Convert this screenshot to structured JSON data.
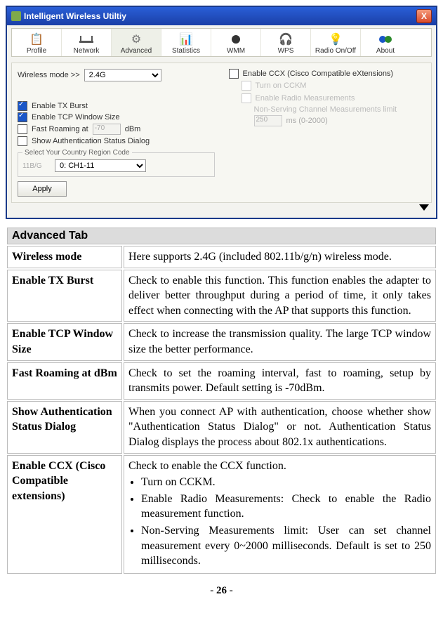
{
  "window": {
    "title": "Intelligent Wireless Utiltiy",
    "close": "X"
  },
  "toolbar": {
    "items": [
      {
        "label": "Profile",
        "icon": "📋"
      },
      {
        "label": "Network",
        "icon": "📶"
      },
      {
        "label": "Advanced",
        "icon": "⚙",
        "active": true
      },
      {
        "label": "Statistics",
        "icon": "📊"
      },
      {
        "label": "WMM",
        "icon": "🎚"
      },
      {
        "label": "WPS",
        "icon": "🔒"
      },
      {
        "label": "Radio On/Off",
        "icon": "💡"
      },
      {
        "label": "About",
        "icon": "ℹ"
      }
    ]
  },
  "wireless_mode": {
    "label": "Wireless mode >>",
    "value": "2.4G"
  },
  "left": {
    "enable_tx_burst": {
      "label": "Enable TX Burst",
      "checked": true
    },
    "enable_tcp_window": {
      "label": "Enable TCP Window Size",
      "checked": true
    },
    "fast_roaming": {
      "label": "Fast Roaming at",
      "checked": false,
      "value": "-70",
      "unit": "dBm"
    },
    "show_auth": {
      "label": "Show Authentication Status Dialog",
      "checked": false
    },
    "region_legend": "Select Your Country Region Code",
    "region_prefix": "11B/G",
    "region_value": "0: CH1-11"
  },
  "right": {
    "enable_ccx": {
      "label": "Enable CCX (Cisco Compatible eXtensions)",
      "checked": false
    },
    "turn_on_cckm": "Turn on CCKM",
    "enable_radio": "Enable Radio Measurements",
    "non_serving": "Non-Serving Channel Measurements limit",
    "ms_value": "250",
    "ms_range": "ms (0-2000)"
  },
  "apply": "Apply",
  "doc": {
    "header": "Advanced Tab",
    "rows": [
      {
        "key": "Wireless mode",
        "desc": "Here supports 2.4G (included 802.11b/g/n) wireless mode."
      },
      {
        "key": "Enable TX Burst",
        "desc": "Check to enable this function. This function enables the adapter to deliver better throughput during a period of time, it only takes effect when connecting with the AP that supports this function."
      },
      {
        "key": "Enable TCP Window Size",
        "desc": "Check to increase the transmission quality. The large TCP window size the better performance."
      },
      {
        "key": "Fast Roaming at dBm",
        "desc": "Check to set the roaming interval, fast to roaming, setup by transmits power. Default setting is -70dBm."
      },
      {
        "key": "Show Authentication Status Dialog",
        "desc": "When you connect AP with authentication, choose whether show \"Authentication Status Dialog\" or not. Authentication Status Dialog displays the process about 802.1x authentications."
      },
      {
        "key": "Enable CCX (Cisco Compatible extensions)",
        "desc_intro": "Check to enable the CCX function.",
        "bullets": [
          "Turn on CCKM.",
          "Enable Radio Measurements: Check to enable the Radio measurement function.",
          "Non-Serving Measurements limit: User can set channel measurement every 0~2000 milliseconds. Default is set to 250 milliseconds."
        ]
      }
    ]
  },
  "page": "- 26 -"
}
